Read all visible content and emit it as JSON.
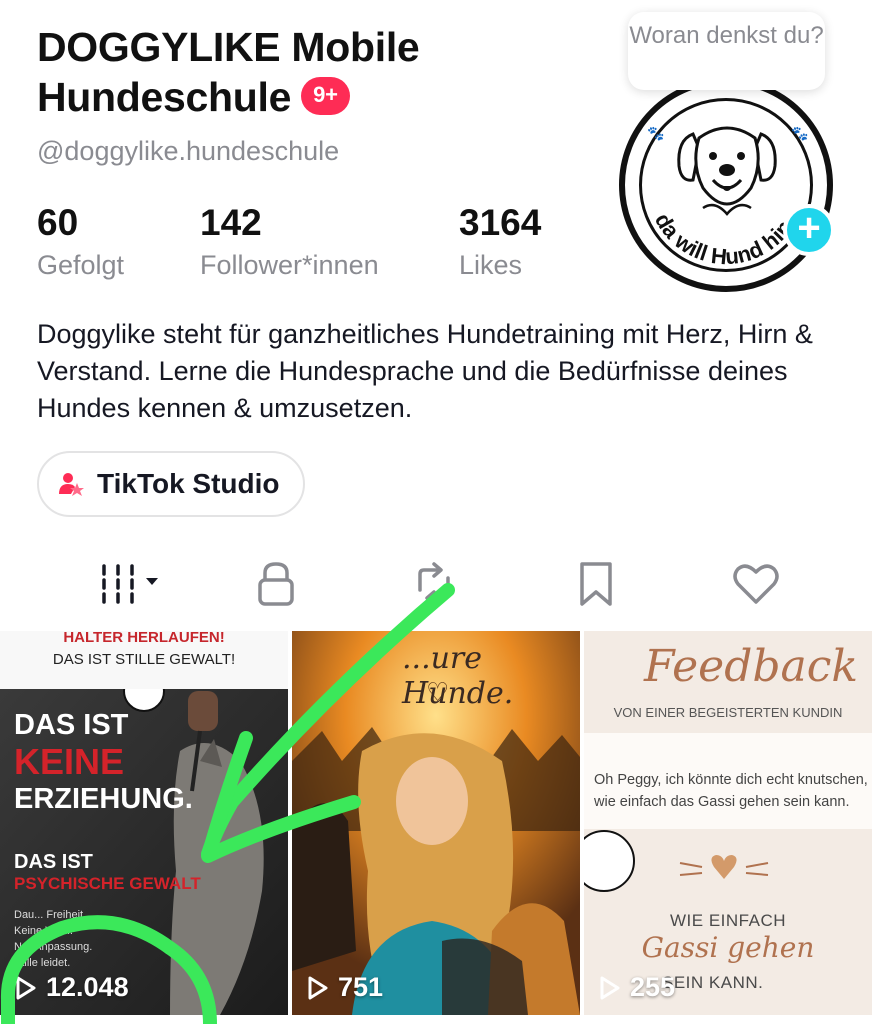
{
  "profile": {
    "name_line1": "DOGGYLIKE Mobile",
    "name_line2": "Hundeschule",
    "notification_badge": "9+",
    "handle": "@doggylike.hundeschule",
    "bubble_text": "Woran denkst du?",
    "avatar_text": "da will Hund hin.",
    "stats": [
      {
        "value": "60",
        "label": "Gefolgt"
      },
      {
        "value": "142",
        "label": "Follower*innen"
      },
      {
        "value": "3164",
        "label": "Likes"
      }
    ],
    "bio": "Doggylike steht für ganzheitliches Hundetraining mit Herz, Hirn & Verstand. Lerne die Hundesprache und die Bedürfnisse deines Hundes kennen & umzusetzen.",
    "studio_button": "TikTok Studio"
  },
  "tabs": [
    {
      "icon": "videos-grid-icon"
    },
    {
      "icon": "lock-icon"
    },
    {
      "icon": "repost-icon"
    },
    {
      "icon": "bookmark-icon"
    },
    {
      "icon": "heart-icon"
    }
  ],
  "videos": [
    {
      "views": "12.048",
      "top1": "HALTER HERLAUFEN!",
      "top2": "DAS IST STILLE GEWALT!",
      "title1": "DAS IST",
      "title2": "KEINE",
      "title3": "ERZIEHUNG.",
      "sub1": "DAS IST",
      "sub2": "PSYCHISCHE GEWALT",
      "small": "Dau... Freiheit.\nKeine Wahl.\nNur Anpassung.\nStille leidet."
    },
    {
      "views": "751",
      "title": "...ure Hunde."
    },
    {
      "views": "255",
      "title": "Feedback",
      "subtitle": "VON EINER BEGEISTERTEN KUNDIN",
      "quote": "Oh Peggy, ich könnte dich echt knutschen, wie einfach das Gassi gehen sein kann.",
      "bottom1": "WIE EINFACH",
      "bottom_script": "Gassi gehen",
      "bottom2": "SEIN KANN."
    }
  ],
  "colors": {
    "accent_red": "#fe2c55",
    "add_button": "#20d5ec",
    "annotation_green": "#3be85a"
  }
}
